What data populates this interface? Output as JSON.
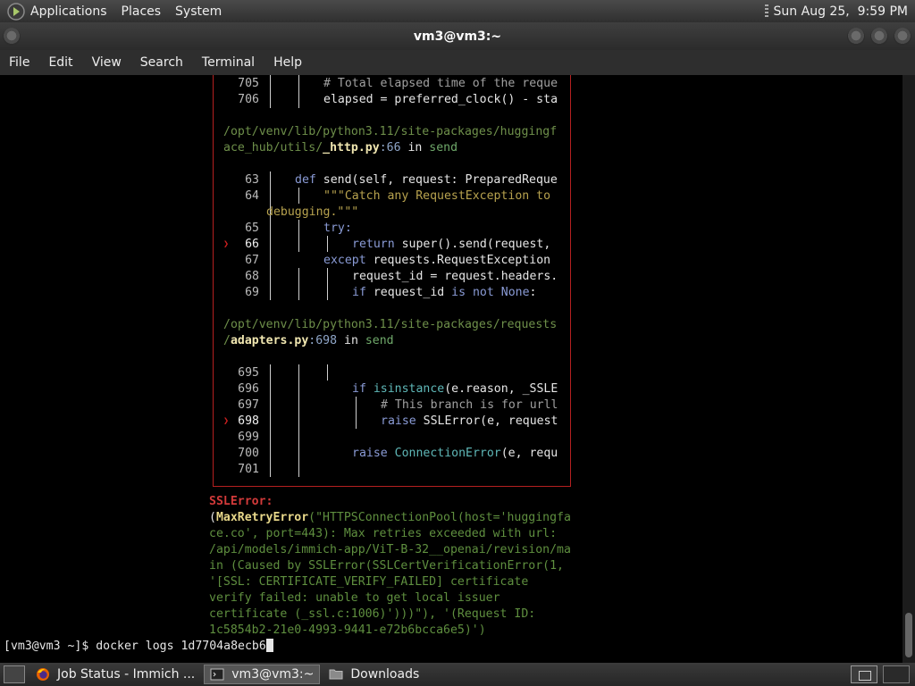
{
  "top_panel": {
    "menus": [
      "Applications",
      "Places",
      "System"
    ],
    "datetime": "Sun Aug 25,  9:59 PM"
  },
  "window": {
    "title": "vm3@vm3:~"
  },
  "menubar": [
    "File",
    "Edit",
    "View",
    "Search",
    "Terminal",
    "Help"
  ],
  "traceback": {
    "block1": [
      {
        "num": "705",
        "code": "# Total elapsed time of the reque"
      },
      {
        "num": "706",
        "code": "elapsed = preferred_clock() - sta"
      }
    ],
    "frame1": {
      "path_line1": "/opt/venv/lib/python3.11/site-packages/huggingf",
      "path_line2_prefix": "ace_hub/utils/",
      "file": "_http.py",
      "lineno": ":66",
      "in_word": " in ",
      "func": "send"
    },
    "block2": [
      {
        "num": "63",
        "kw": "def ",
        "rest": "send(self, request: PreparedReque"
      },
      {
        "num": "64",
        "code": "\"\"\"Catch any RequestException to"
      },
      {
        "num": "",
        "code": "debugging.\"\"\""
      },
      {
        "num": "65",
        "code": "try:"
      },
      {
        "num": "66",
        "kw": "return ",
        "rest": "super().send(request,"
      },
      {
        "num": "67",
        "kw": "except ",
        "rest": "requests.RequestException"
      },
      {
        "num": "68",
        "code": "request_id = request.headers."
      },
      {
        "num": "69",
        "kw": "if ",
        "rest": "request_id ",
        "kw2": "is not None",
        "tail": ":"
      }
    ],
    "frame2": {
      "path_line1": "/opt/venv/lib/python3.11/site-packages/requests",
      "path_slash": "/",
      "file": "adapters.py",
      "lineno": ":698",
      "in_word": " in ",
      "func": "send"
    },
    "block3": [
      {
        "num": "695",
        "code": ""
      },
      {
        "num": "696",
        "kw": "if ",
        "fn": "isinstance",
        "rest": "(e.reason, _SSLE"
      },
      {
        "num": "697",
        "code": "# This branch is for urll"
      },
      {
        "num": "698",
        "kw": "raise ",
        "rest": "SSLError(e, request"
      },
      {
        "num": "699",
        "code": ""
      },
      {
        "num": "700",
        "kw": "raise ",
        "cls": "ConnectionError",
        "rest": "(e, requ"
      },
      {
        "num": "701",
        "code": ""
      }
    ],
    "error_name": "SSLError:",
    "error_lines": [
      {
        "open": "(",
        "cls": "MaxRetryError",
        "rest": "(\"HTTPSConnectionPool(host='huggingfa"
      },
      {
        "text": "ce.co', port=443): Max retries exceeded with url:"
      },
      {
        "text": "/api/models/immich-app/ViT-B-32__openai/revision/ma"
      },
      {
        "text": "in (Caused by SSLError(SSLCertVerificationError(1,"
      },
      {
        "text": "'[SSL: CERTIFICATE_VERIFY_FAILED] certificate"
      },
      {
        "text": "verify failed: unable to get local issuer"
      },
      {
        "text": "certificate (_ssl.c:1006)')))\"), '(Request ID:"
      },
      {
        "text": "1c5854b2-21e0-4993-9441-e72b6bcca6e5)')"
      }
    ],
    "error_tail": "')",
    "marker_glyph": "❯"
  },
  "prompt": "[vm3@vm3 ~]$ docker logs 1d7704a8ecb6",
  "taskbar": {
    "tasks": [
      "Job Status - Immich ...",
      "vm3@vm3:~",
      "Downloads"
    ]
  }
}
